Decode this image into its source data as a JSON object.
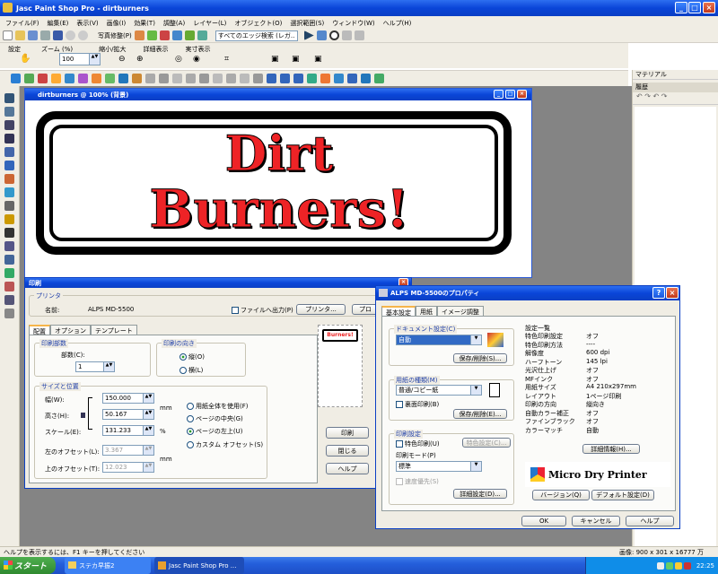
{
  "app": {
    "title": "Jasc Paint Shop Pro - dirtburners"
  },
  "menu": [
    "ファイル(F)",
    "編集(E)",
    "表示(V)",
    "画像(I)",
    "効果(T)",
    "調整(A)",
    "レイヤー(L)",
    "オブジェクト(O)",
    "選択範囲(S)",
    "ウィンドウ(W)",
    "ヘルプ(H)"
  ],
  "toolbar": {
    "photo_fix": "写真修整(P)",
    "edge_search": "すべてのエッジ検索 (レガ.."
  },
  "tool_options": {
    "settings": "設定",
    "zoom_label": "ズーム (%)",
    "zoom_value": "100",
    "shrink_enlarge": "縮小/拡大",
    "detail_view": "詳細表示",
    "actual_size": "実寸表示"
  },
  "palettes": {
    "materials": "マテリアル",
    "history": "履歴"
  },
  "document": {
    "title": "dirtburners @ 100% (背景)",
    "logo_line1": "Dirt",
    "logo_line2": "Burners!"
  },
  "print_dialog": {
    "title": "印刷",
    "printer_group": "プリンタ",
    "name_label": "名前:",
    "printer_name": "ALPS MD-5500",
    "print_to_file": "ファイルへ出力(P)",
    "printer_btn": "プリンタ...",
    "prop_btn": "プロ",
    "tabs": [
      "配置",
      "オプション",
      "テンプレート"
    ],
    "copies_group": "印刷部数",
    "copies_label": "部数(C):",
    "copies_value": "1",
    "orientation_group": "印刷の向き",
    "portrait": "縦(O)",
    "landscape": "横(L)",
    "size_group": "サイズと位置",
    "width_label": "幅(W):",
    "width_value": "150.000",
    "height_label": "高さ(H):",
    "height_value": "50.167",
    "scale_label": "スケール(E):",
    "scale_value": "131.233",
    "unit_mm": "mm",
    "unit_pct": "%",
    "fit_page": "用紙全体を使用(F)",
    "center_page": "ページの中央(G)",
    "top_left": "ページの左上(U)",
    "custom_offset": "カスタム オフセット(S)",
    "left_offset_label": "左のオフセット(L):",
    "left_offset_value": "3.367",
    "top_offset_label": "上のオフセット(T):",
    "top_offset_value": "12.023",
    "print_btn": "印刷",
    "close_btn": "閉じる",
    "help_btn": "ヘルプ"
  },
  "props_dialog": {
    "title": "ALPS MD-5500のプロパティ",
    "tabs": [
      "基本設定",
      "用紙",
      "イメージ調整"
    ],
    "doc_group": "ドキュメント設定(C)",
    "doc_value": "自動",
    "save_delete1": "保存/削除(S)...",
    "paper_group": "用紙の種類(M)",
    "paper_value": "普通/コピー紙",
    "reverse_print": "裏面印刷(B)",
    "save_delete2": "保存/削除(E)...",
    "print_group": "印刷設定",
    "special_color": "特色印刷(U)",
    "special_setting": "特色設定(C)...",
    "mode_label": "印刷モード(P)",
    "mode_value": "標準",
    "speed_priority": "速度優先(S)",
    "detail_setting": "詳細設定(D)...",
    "list_title": "設定一覧",
    "settings": [
      [
        "特色印刷設定",
        "オフ"
      ],
      [
        "特色印刷方法",
        "----"
      ],
      [
        "解像度",
        "600 dpi"
      ],
      [
        "ハーフトーン",
        "145 lpi"
      ],
      [
        "光沢仕上げ",
        "オフ"
      ],
      [
        "MFインク",
        "オフ"
      ],
      [
        "用紙サイズ",
        "A4 210x297mm"
      ],
      [
        "レイアウト",
        "1ページ印刷"
      ],
      [
        "印刷の方向",
        "縦向き"
      ],
      [
        "自動カラー補正",
        "オフ"
      ],
      [
        "ファインブラック",
        "オフ"
      ],
      [
        "カラーマッチ",
        "自動"
      ]
    ],
    "detail_info": "詳細情報(H)...",
    "brand": "Micro Dry Printer",
    "version_btn": "バージョン(Q)",
    "default_btn": "デフォルト設定(D)",
    "ok": "OK",
    "cancel": "キャンセル",
    "help": "ヘルプ"
  },
  "status": {
    "help_text": "ヘルプを表示するには、F1 キーを押してください",
    "image_info": "画像: 900 x 301 x 16777 万"
  },
  "taskbar": {
    "start": "スタート",
    "item1": "ステカ早振2",
    "item2": "Jasc Paint Shop Pro ...",
    "clock": "22:25"
  }
}
